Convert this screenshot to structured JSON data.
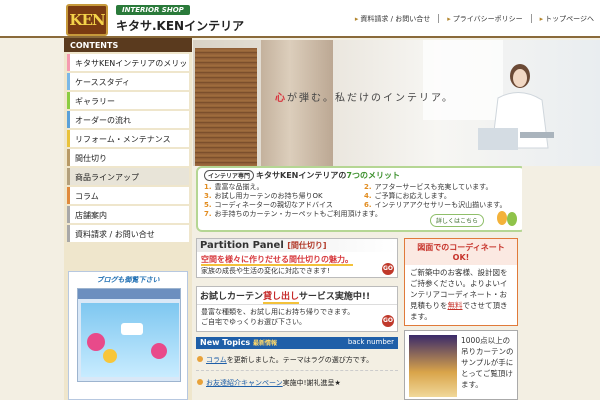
{
  "header": {
    "logo": "KEN",
    "shop_tag": "INTERIOR SHOP",
    "brand": "キタサ.KENインテリア",
    "nav": [
      "資料請求 / お問い合せ",
      "プライバシーポリシー",
      "トップページへ"
    ]
  },
  "sidebar": {
    "title": "CONTENTS",
    "items": [
      {
        "label": "キタサKENインテリアのメリット"
      },
      {
        "label": "ケーススタディ"
      },
      {
        "label": "ギャラリー"
      },
      {
        "label": "オーダーの流れ"
      },
      {
        "label": "リフォーム・メンテナンス"
      },
      {
        "label": "間仕切り"
      },
      {
        "label": "商品ラインアップ"
      },
      {
        "label": "コラム"
      },
      {
        "label": "店舗案内"
      },
      {
        "label": "資料請求 / お問い合せ"
      }
    ],
    "blog_label": "ブログも御覧下さい"
  },
  "hero": {
    "copy_a": "心",
    "copy_b": "が弾む。私だけのインテリア。"
  },
  "merit": {
    "tag": "インテリア専門",
    "title_a": "キタサKENインテリアの",
    "title_b": "7つのメリット",
    "items": [
      {
        "num": "1.",
        "text": "豊富な品揃え。"
      },
      {
        "num": "2.",
        "text": "アフターサービスも充実しています。"
      },
      {
        "num": "3.",
        "text": "お試し用カーテンのお持ち帰りOK"
      },
      {
        "num": "4.",
        "text": "ご予算にお応えします。"
      },
      {
        "num": "5.",
        "text": "コーディネーターの親切なアドバイス"
      },
      {
        "num": "6.",
        "text": "インテリアアクセサリーも沢山揃います。"
      },
      {
        "num": "7.",
        "text": "お手持ちのカーテン・カーペットもご利用頂けます。"
      }
    ],
    "more": "詳しくはこちら"
  },
  "partition": {
    "title": "Partition Panel",
    "bracket": "[間仕切り]",
    "line1": "空間を様々に作りだせる間仕切りの魅力。",
    "line2": "家族の成長や生活の変化に対応できます!",
    "go": "GO"
  },
  "rental": {
    "title_a": "お試しカーテン",
    "title_b": "貸し出し",
    "title_c": "サービス実施中!!",
    "body1": "豊富な種類を、お試し用にお持ち帰りできます。",
    "body2": "ご自宅でゆっくりお選び下さい。",
    "go": "GO"
  },
  "topics": {
    "title": "New Topics",
    "sub": "最新情報",
    "back": "back number",
    "items": [
      {
        "link": "コラム",
        "text": "を更新しました。テーマはラグの選び方です。"
      },
      {
        "link": "お友達紹介キャンペーン",
        "text": "実施中!謝礼進呈★"
      }
    ]
  },
  "coordinate": {
    "title": "図面でのコーディネートOK!",
    "body_a": "ご新築中のお客様、設計図をご持参ください。よりよいインテリアコーディネート・お見積もりを",
    "body_free": "無料",
    "body_b": "でさせて頂きます。"
  },
  "sample": {
    "text": "1000点以上の吊りカーテンのサンプルが手にとってご覧頂けます。"
  }
}
